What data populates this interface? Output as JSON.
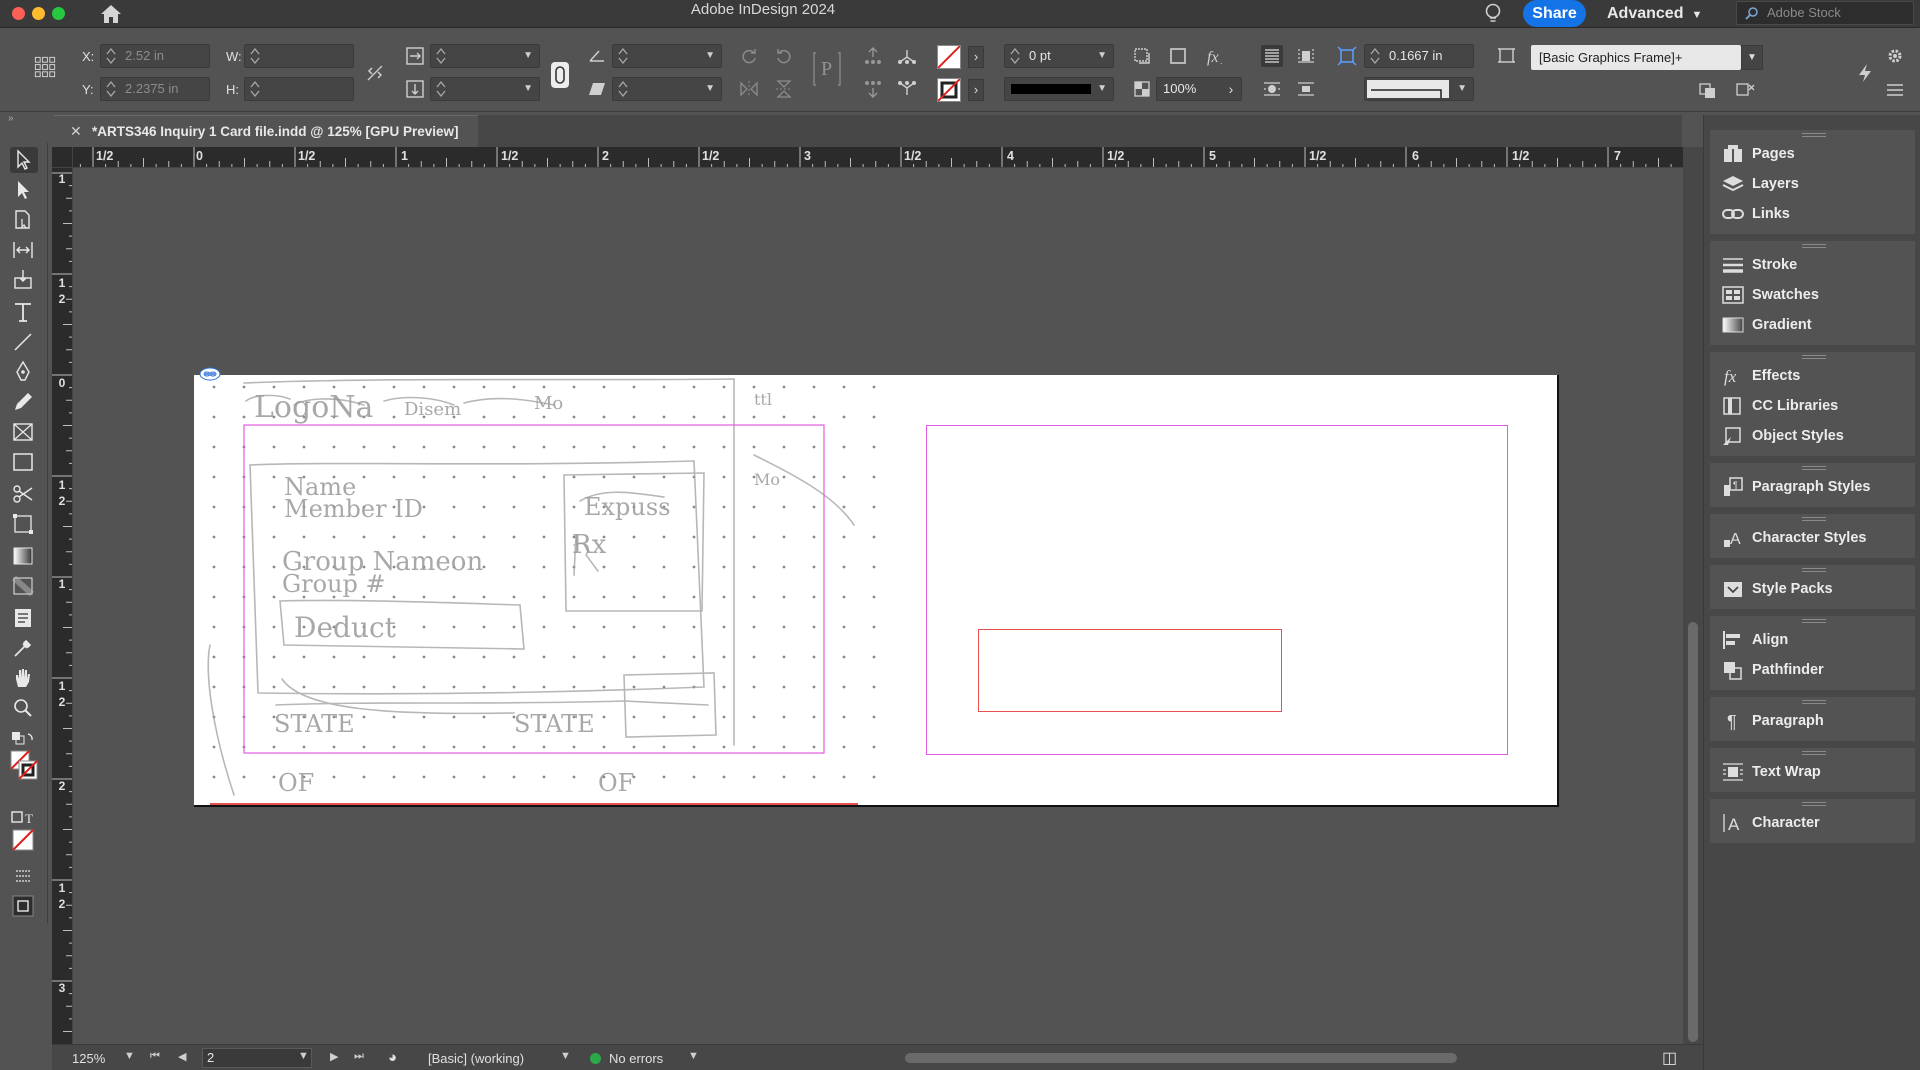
{
  "window": {
    "app_title": "Adobe InDesign 2024",
    "share_label": "Share",
    "workspace_label": "Advanced",
    "stock_search_placeholder": "Adobe Stock"
  },
  "controlbar": {
    "x_label": "X:",
    "x_value": "2.52 in",
    "y_label": "Y:",
    "y_value": "2.2375 in",
    "w_label": "W:",
    "w_value": "",
    "h_label": "H:",
    "h_value": "",
    "stroke_weight": "0 pt",
    "opacity": "100%",
    "offset_value": "0.1667 in",
    "object_style": "[Basic Graphics Frame]+",
    "fill_color": "none",
    "stroke_color": "none"
  },
  "document_tab": {
    "title": "*ARTS346 Inquiry 1 Card file.indd @ 125% [GPU Preview]"
  },
  "rulers": {
    "horizontal": [
      "1/2",
      "0",
      "1/2",
      "1",
      "1/2",
      "2",
      "1/2",
      "3",
      "1/2",
      "4",
      "1/2",
      "5",
      "1/2",
      "6",
      "1/2",
      "7"
    ],
    "vertical": [
      "1",
      "1\n2",
      "0",
      "1\n2",
      "1",
      "1\n2",
      "2",
      "1\n2",
      "3"
    ]
  },
  "statusbar": {
    "zoom": "125%",
    "page": "2",
    "preflight_profile": "[Basic] (working)",
    "preflight_status": "No errors",
    "status_color": "#2ba84a"
  },
  "panels": {
    "group1": [
      {
        "label": "Pages",
        "icon": "pages-icon"
      },
      {
        "label": "Layers",
        "icon": "layers-icon"
      },
      {
        "label": "Links",
        "icon": "links-icon"
      }
    ],
    "group2": [
      {
        "label": "Stroke",
        "icon": "stroke-icon"
      },
      {
        "label": "Swatches",
        "icon": "swatches-icon"
      },
      {
        "label": "Gradient",
        "icon": "gradient-icon"
      }
    ],
    "group3": [
      {
        "label": "Effects",
        "icon": "effects-icon"
      },
      {
        "label": "CC Libraries",
        "icon": "cc-libraries-icon"
      },
      {
        "label": "Object Styles",
        "icon": "object-styles-icon"
      }
    ],
    "group4": [
      {
        "label": "Paragraph Styles",
        "icon": "paragraph-styles-icon"
      }
    ],
    "group5": [
      {
        "label": "Character Styles",
        "icon": "character-styles-icon"
      }
    ],
    "group6": [
      {
        "label": "Style Packs",
        "icon": "style-packs-icon"
      }
    ],
    "group7": [
      {
        "label": "Align",
        "icon": "align-icon"
      },
      {
        "label": "Pathfinder",
        "icon": "pathfinder-icon"
      }
    ],
    "group8": [
      {
        "label": "Paragraph",
        "icon": "paragraph-icon"
      }
    ],
    "group9": [
      {
        "label": "Text Wrap",
        "icon": "text-wrap-icon"
      }
    ],
    "group10": [
      {
        "label": "Character",
        "icon": "character-icon"
      }
    ]
  },
  "colors": {
    "margin_guide": "#e35ce0",
    "selected_frame": "#e85050",
    "share_button": "#1473e6"
  }
}
